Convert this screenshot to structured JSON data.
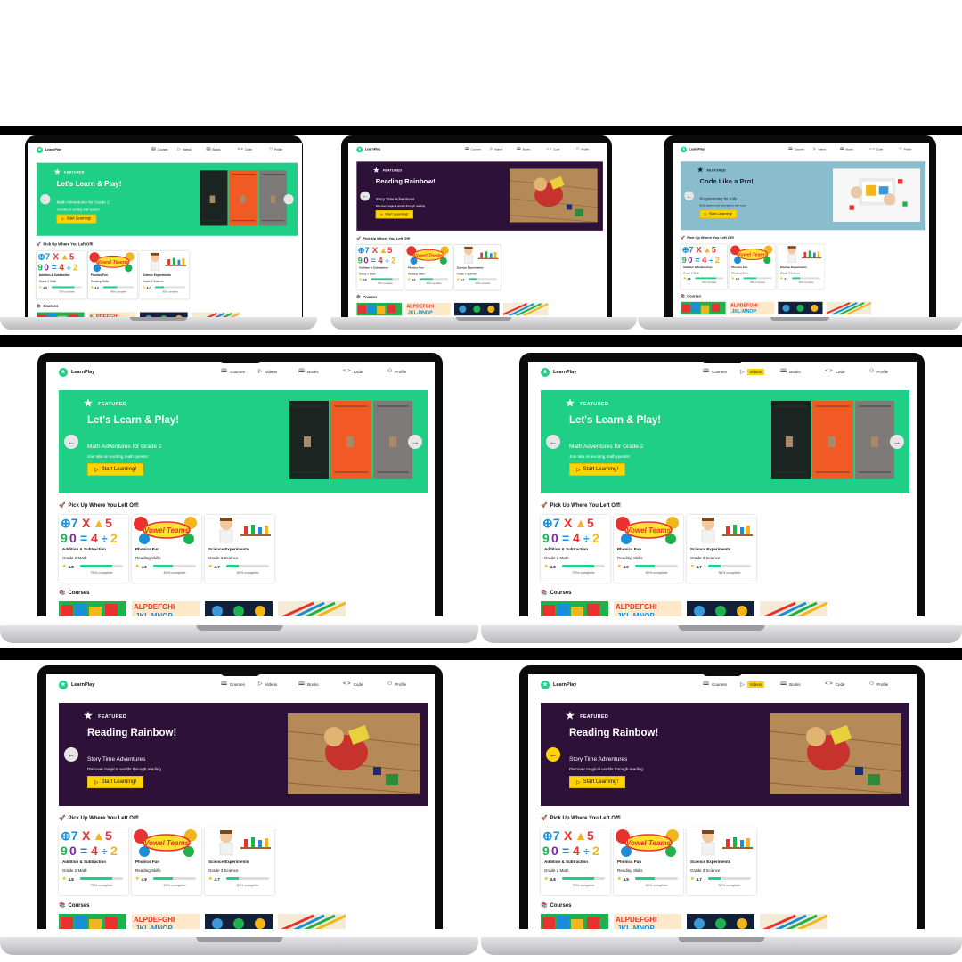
{
  "app": {
    "brand": "LearnPlay",
    "nav": [
      {
        "label": "Courses",
        "icon": "book-icon"
      },
      {
        "label": "Videos",
        "icon": "play-icon"
      },
      {
        "label": "Books",
        "icon": "open-book-icon"
      },
      {
        "label": "Code",
        "icon": "code-icon"
      },
      {
        "label": "Profile",
        "icon": "user-icon"
      }
    ],
    "featured_label": "FEATURED",
    "cta_label": "Start Learning!",
    "continue_title": "Pick Up Where You Left Off!",
    "courses_title": "Courses",
    "cards": [
      {
        "title": "Addition & Subtraction",
        "grade": "Grade 2 Math",
        "rating": "4.8",
        "progress": 75,
        "progress_label": "75% complete"
      },
      {
        "title": "Phonics Fun",
        "grade": "Reading Skills",
        "rating": "4.9",
        "progress": 45,
        "progress_label": "45% complete"
      },
      {
        "title": "Science Experiments",
        "grade": "Grade 3 Science",
        "rating": "4.7",
        "progress": 30,
        "progress_label": "30% complete"
      }
    ]
  },
  "slides": {
    "math": {
      "title": "Let's Learn & Play!",
      "subtitle": "Math Adventures for Grade 2",
      "desc": "Join Mia on exciting math quests!",
      "color": "#1fcf86"
    },
    "reading": {
      "title": "Reading Rainbow!",
      "subtitle": "Story Time Adventures",
      "desc": "Discover magical worlds through reading",
      "color": "#2e1138"
    },
    "code": {
      "title": "Code Like a Pro!",
      "subtitle": "Programming for Kids",
      "desc": "Build games and animations with code",
      "color": "#89bccd"
    }
  },
  "colors": {
    "accent_green": "#1fcf86",
    "accent_yellow": "#ffd400",
    "purple": "#2e1138",
    "teal": "#89bccd"
  }
}
